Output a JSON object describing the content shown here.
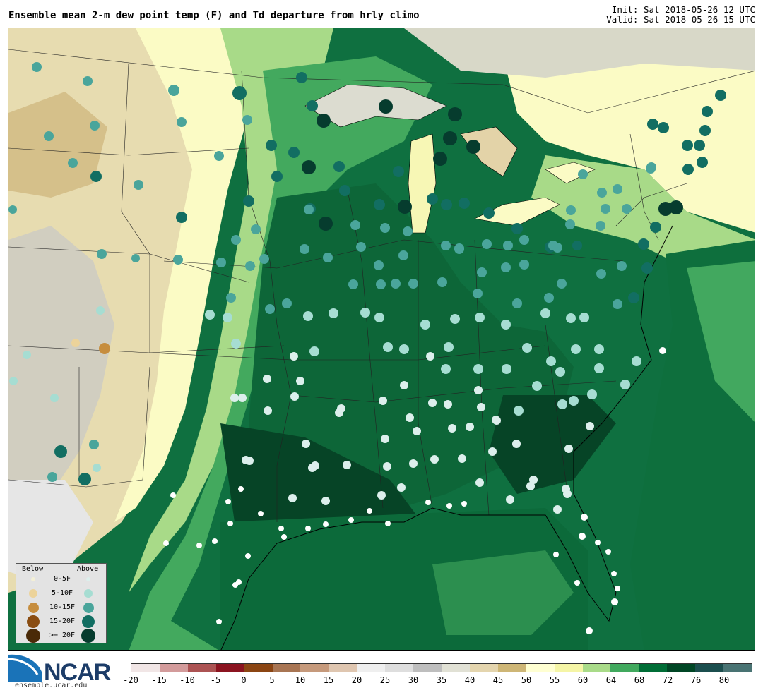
{
  "header": {
    "title": "Ensemble mean 2-m dew point temp (F) and Td departure from hrly climo",
    "init": "Init: Sat 2018-05-26 12 UTC",
    "valid": "Valid: Sat 2018-05-26 15 UTC"
  },
  "legend": {
    "below_label": "Below",
    "above_label": "Above",
    "rows": [
      {
        "label": "0-5F",
        "below_color": "#f4f0d6",
        "above_color": "#dcefec"
      },
      {
        "label": "5-10F",
        "below_color": "#ecd39a",
        "above_color": "#a6ddd2"
      },
      {
        "label": "10-15F",
        "below_color": "#c68d3e",
        "above_color": "#4aa59b"
      },
      {
        "label": "15-20F",
        "below_color": "#8a4d12",
        "above_color": "#126e62"
      },
      {
        "label": ">= 20F",
        "below_color": "#4a2a08",
        "above_color": "#063c2e"
      }
    ]
  },
  "colorbar": {
    "colors": [
      "#f1e6e6",
      "#d39b9b",
      "#ac5353",
      "#8b1420",
      "#8b4513",
      "#a87553",
      "#c69a7c",
      "#dfc6b0",
      "#efefef",
      "#dedede",
      "#bebebe",
      "#e1e1d5",
      "#e4d5ae",
      "#ceb676",
      "#ffffd2",
      "#f5f5a6",
      "#a9db89",
      "#41a95e",
      "#006d36",
      "#004625",
      "#1b4e4e",
      "#497373"
    ],
    "ticks": [
      "-20",
      "-15",
      "-10",
      "-5",
      "0",
      "5",
      "10",
      "15",
      "20",
      "25",
      "30",
      "35",
      "40",
      "45",
      "50",
      "55",
      "60",
      "64",
      "68",
      "72",
      "76",
      "80"
    ]
  },
  "branding": {
    "logo_text": "NCAR",
    "url": "ensemble.ucar.edu"
  }
}
